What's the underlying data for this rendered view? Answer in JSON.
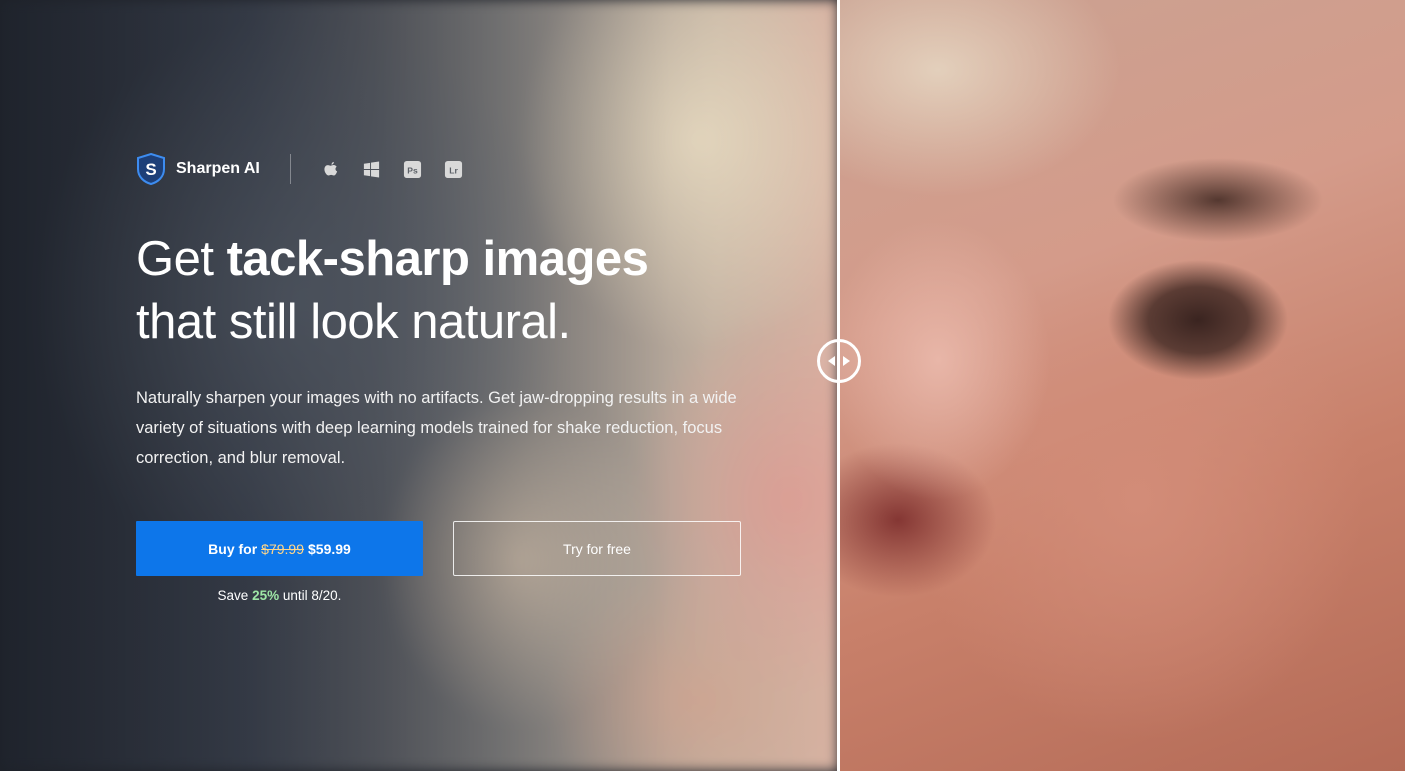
{
  "brand": {
    "name": "Sharpen AI",
    "logo_letter": "S",
    "platforms": [
      {
        "name": "apple-icon"
      },
      {
        "name": "windows-icon"
      },
      {
        "name": "photoshop-icon",
        "label": "Ps"
      },
      {
        "name": "lightroom-icon",
        "label": "Lr"
      }
    ]
  },
  "hero": {
    "headline_plain_1": "Get ",
    "headline_bold": "tack-sharp images",
    "headline_plain_2": "that still look natural.",
    "description": "Naturally sharpen your images with no artifacts. Get jaw-dropping results in a wide variety of situations with deep learning models trained for shake reduction, focus correction, and blur removal."
  },
  "cta": {
    "buy_prefix": "Buy for",
    "old_price": "$79.99",
    "new_price": "$59.99",
    "try_label": "Try for free",
    "promo_prefix": "Save",
    "promo_percent": "25%",
    "promo_suffix": "until 8/20."
  },
  "compare_slider": {
    "position": 0.597
  },
  "colors": {
    "buy_button": "#0d76ea",
    "promo_percent": "#9ee6a6",
    "logo_blue": "#3d8cf0"
  }
}
